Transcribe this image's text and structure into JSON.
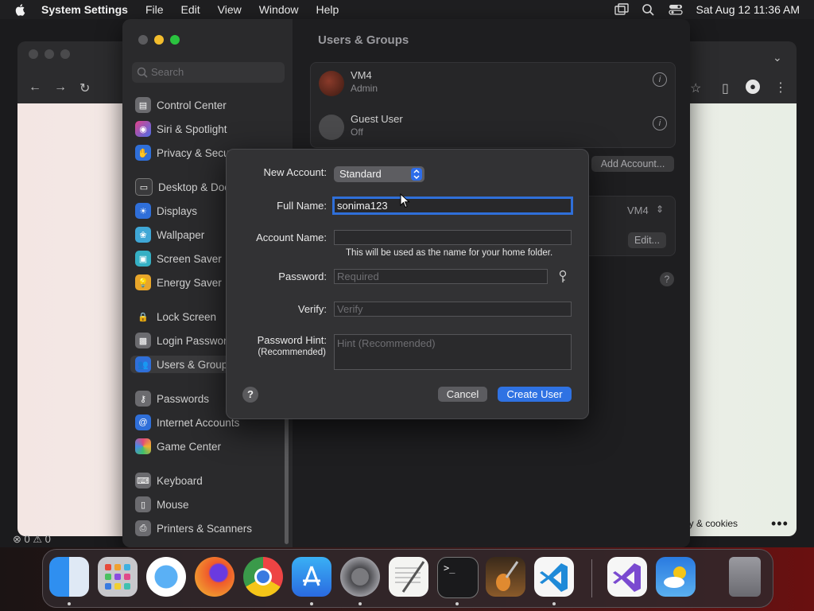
{
  "menubar": {
    "app_name": "System Settings",
    "menus": [
      "File",
      "Edit",
      "View",
      "Window",
      "Help"
    ],
    "clock": "Sat Aug 12  11:36 AM"
  },
  "browser": {
    "footer_link": "vacy & cookies",
    "status": "⊗ 0 ⚠ 0"
  },
  "settings": {
    "search_placeholder": "Search",
    "sidebar": [
      {
        "label": "Control Center",
        "icon": "control-center-icon",
        "color": "#6b6b6f"
      },
      {
        "label": "Siri & Spotlight",
        "icon": "siri-icon",
        "color": "#8a3fd1"
      },
      {
        "label": "Privacy & Secu",
        "icon": "privacy-hand-icon",
        "color": "#2f6fd9"
      },
      {
        "label": "Desktop & Doc",
        "icon": "desktop-icon",
        "color": "#3a3a3c"
      },
      {
        "label": "Displays",
        "icon": "displays-icon",
        "color": "#2f6fd9"
      },
      {
        "label": "Wallpaper",
        "icon": "wallpaper-icon",
        "color": "#3fa7d6"
      },
      {
        "label": "Screen Saver",
        "icon": "screen-saver-icon",
        "color": "#35b0c4"
      },
      {
        "label": "Energy Saver",
        "icon": "energy-icon",
        "color": "#e8a62a"
      },
      {
        "label": "Lock Screen",
        "icon": "lock-icon",
        "color": "#2a2a2c"
      },
      {
        "label": "Login Passwor",
        "icon": "login-password-icon",
        "color": "#6b6b6f"
      },
      {
        "label": "Users & Group",
        "icon": "users-icon",
        "color": "#2f6fd9"
      },
      {
        "label": "Passwords",
        "icon": "key-icon",
        "color": "#6b6b6f"
      },
      {
        "label": "Internet Accounts",
        "icon": "at-icon",
        "color": "#2f6fd9"
      },
      {
        "label": "Game Center",
        "icon": "game-center-icon",
        "color": "#e04a7a"
      },
      {
        "label": "Keyboard",
        "icon": "keyboard-icon",
        "color": "#6b6b6f"
      },
      {
        "label": "Mouse",
        "icon": "mouse-icon",
        "color": "#6b6b6f"
      },
      {
        "label": "Printers & Scanners",
        "icon": "printer-icon",
        "color": "#6b6b6f"
      }
    ],
    "title": "Users & Groups",
    "users": [
      {
        "name": "VM4",
        "role": "Admin"
      },
      {
        "name": "Guest User",
        "role": "Off"
      }
    ],
    "add_account": "Add Account...",
    "auto_login_value": "VM4",
    "edit": "Edit..."
  },
  "dialog": {
    "new_account_label": "New Account:",
    "new_account_value": "Standard",
    "full_name_label": "Full Name:",
    "full_name_value": "sonima123",
    "account_name_label": "Account Name:",
    "account_name_value": "",
    "account_name_note": "This will be used as the name for your home folder.",
    "password_label": "Password:",
    "password_placeholder": "Required",
    "verify_label": "Verify:",
    "verify_placeholder": "Verify",
    "hint_label": "Password Hint:",
    "hint_sublabel": "(Recommended)",
    "hint_placeholder": "Hint (Recommended)",
    "help": "?",
    "cancel": "Cancel",
    "create": "Create User"
  },
  "dock": {
    "apps": [
      "finder-icon",
      "launchpad-icon",
      "safari-icon",
      "firefox-icon",
      "chrome-icon",
      "app-store-icon",
      "system-settings-icon",
      "textedit-icon",
      "terminal-icon",
      "garageband-icon",
      "vscode-icon",
      "visual-studio-icon",
      "weather-icon",
      "trash-icon"
    ]
  }
}
